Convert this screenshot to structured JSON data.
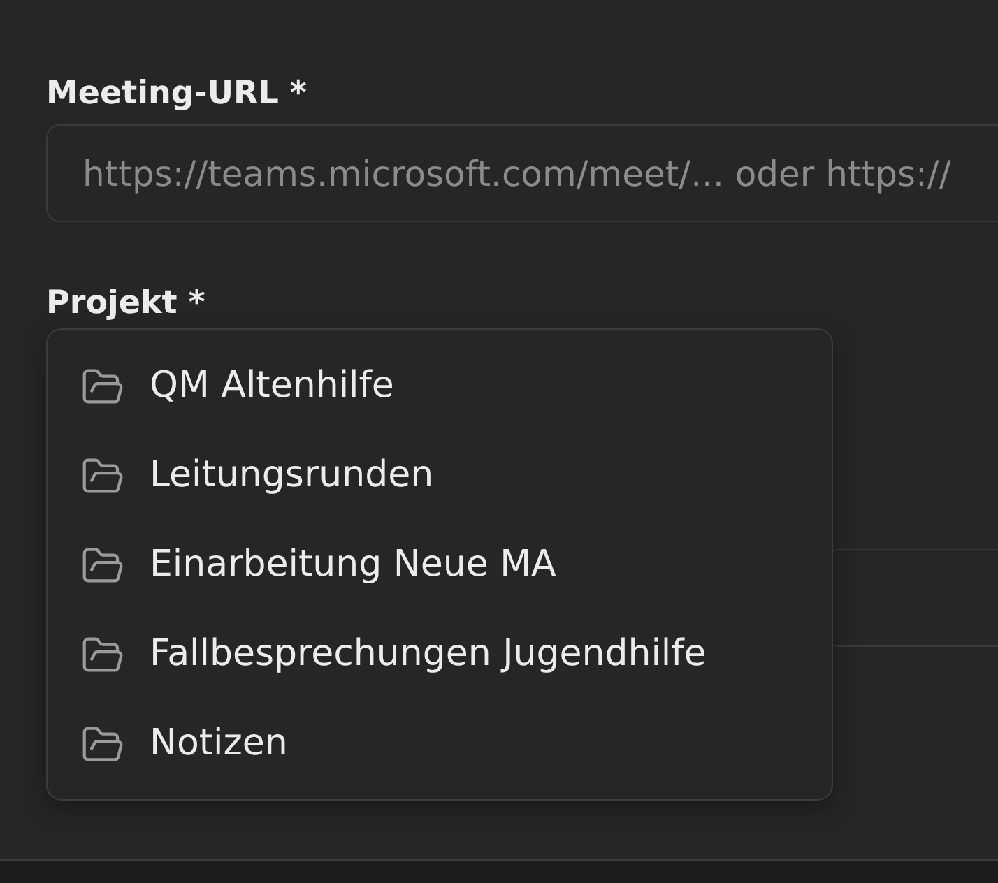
{
  "meeting_url": {
    "label": "Meeting-URL *",
    "placeholder": "https://teams.microsoft.com/meet/... oder https://"
  },
  "project": {
    "label": "Projekt *",
    "expanded": true,
    "options": [
      {
        "label": "QM Altenhilfe",
        "selected": false
      },
      {
        "label": "Leitungsrunden",
        "selected": false
      },
      {
        "label": "Einarbeitung Neue MA",
        "selected": false
      },
      {
        "label": "Fallbesprechungen Jugendhilfe",
        "selected": false
      },
      {
        "label": "Notizen",
        "selected": false
      }
    ]
  }
}
